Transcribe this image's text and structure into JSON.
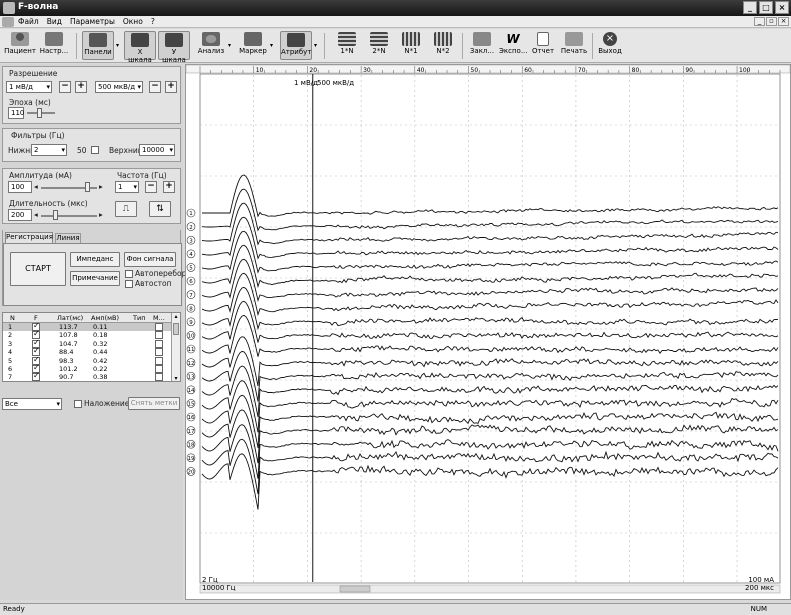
{
  "window": {
    "title": "F-волна"
  },
  "menu": [
    "Файл",
    "Вид",
    "Параметры",
    "Окно",
    "?"
  ],
  "toolbar": {
    "patient": "Пациент",
    "settings": "Настр...",
    "panels": "Панели",
    "xscale": "Х шкала",
    "yscale": "У шкала",
    "analysis": "Анализ",
    "marker": "Маркер",
    "attribute": "Атрибут",
    "n1": "1*N",
    "n2": "2*N",
    "nstar1": "N*1",
    "nstar2": "N*2",
    "bookmark": "Закл...",
    "export": "Экспо...",
    "report": "Отчет",
    "print": "Печать",
    "exit": "Выход"
  },
  "resolution": {
    "label": "Разрешение",
    "sens_value": "1 мВ/д",
    "sweep_value": "500 мкВ/д",
    "epoch_label": "Эпоха (мс)",
    "epoch_value": "110"
  },
  "filters": {
    "label": "Фильтры (Гц)",
    "low_label": "Нижний",
    "low_value": "2",
    "notch_value": "50",
    "high_label": "Верхний",
    "high_value": "10000"
  },
  "stim": {
    "amp_label": "Амплитуда (мА)",
    "amp_value": "100",
    "dur_label": "Длительность (мкс)",
    "dur_value": "200",
    "freq_label": "Частота (Гц)",
    "freq_value": "1"
  },
  "tabs": [
    "Регистрация",
    "Линия"
  ],
  "controls": {
    "start": "СТАРТ",
    "impedance": "Импеданс",
    "background": "Фон сигнала",
    "note": "Примечание",
    "autoselect": "Автоперебор",
    "autostop": "Автостоп"
  },
  "table": {
    "headers": [
      "N",
      "F",
      "Лат(мс)",
      "Амп(мВ)",
      "Тип",
      "М..."
    ],
    "rows": [
      {
        "n": "1",
        "lat": "113.7",
        "amp": "0.11"
      },
      {
        "n": "2",
        "lat": "107.8",
        "amp": "0.18"
      },
      {
        "n": "3",
        "lat": "104.7",
        "amp": "0.32"
      },
      {
        "n": "4",
        "lat": "88.4",
        "amp": "0.44"
      },
      {
        "n": "5",
        "lat": "98.3",
        "amp": "0.42"
      },
      {
        "n": "6",
        "lat": "101.2",
        "amp": "0.22"
      },
      {
        "n": "7",
        "lat": "90.7",
        "amp": "0.38"
      }
    ]
  },
  "bottom": {
    "filter_value": "Все",
    "overlay_label": "Наложение",
    "clear_marks": "Снять метки"
  },
  "plot": {
    "ruler_ticks": [
      "10",
      "20",
      "30",
      "40",
      "50",
      "60",
      "70",
      "80",
      "90",
      "100"
    ],
    "marker_left": "1 мВ/д",
    "marker_right": "500 мкВ/д",
    "bl_top": "2 Гц",
    "bl_bottom": "10000 Гц",
    "br_top": "100 мА",
    "br_bottom": "200 мкс",
    "trace_count": 20
  },
  "status": {
    "left": "Ready",
    "right": "NUM"
  }
}
